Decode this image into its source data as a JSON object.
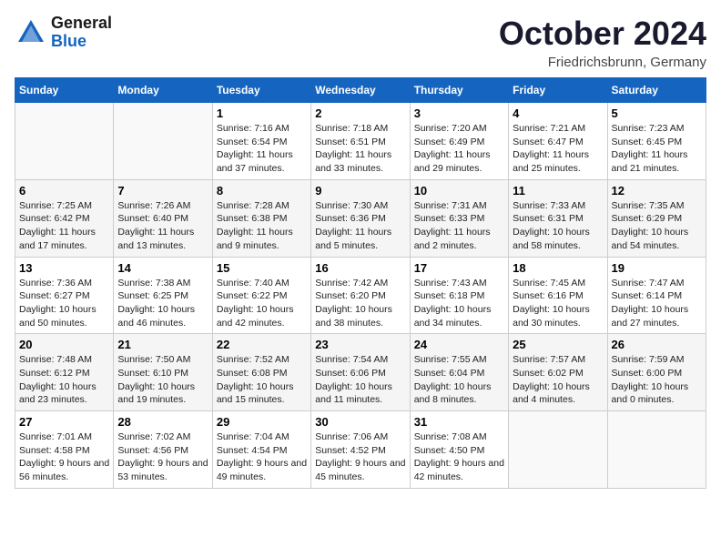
{
  "header": {
    "logo_general": "General",
    "logo_blue": "Blue",
    "month_title": "October 2024",
    "location": "Friedrichsbrunn, Germany"
  },
  "days_of_week": [
    "Sunday",
    "Monday",
    "Tuesday",
    "Wednesday",
    "Thursday",
    "Friday",
    "Saturday"
  ],
  "weeks": [
    [
      {
        "day": "",
        "info": ""
      },
      {
        "day": "",
        "info": ""
      },
      {
        "day": "1",
        "info": "Sunrise: 7:16 AM\nSunset: 6:54 PM\nDaylight: 11 hours\nand 37 minutes."
      },
      {
        "day": "2",
        "info": "Sunrise: 7:18 AM\nSunset: 6:51 PM\nDaylight: 11 hours\nand 33 minutes."
      },
      {
        "day": "3",
        "info": "Sunrise: 7:20 AM\nSunset: 6:49 PM\nDaylight: 11 hours\nand 29 minutes."
      },
      {
        "day": "4",
        "info": "Sunrise: 7:21 AM\nSunset: 6:47 PM\nDaylight: 11 hours\nand 25 minutes."
      },
      {
        "day": "5",
        "info": "Sunrise: 7:23 AM\nSunset: 6:45 PM\nDaylight: 11 hours\nand 21 minutes."
      }
    ],
    [
      {
        "day": "6",
        "info": "Sunrise: 7:25 AM\nSunset: 6:42 PM\nDaylight: 11 hours\nand 17 minutes."
      },
      {
        "day": "7",
        "info": "Sunrise: 7:26 AM\nSunset: 6:40 PM\nDaylight: 11 hours\nand 13 minutes."
      },
      {
        "day": "8",
        "info": "Sunrise: 7:28 AM\nSunset: 6:38 PM\nDaylight: 11 hours\nand 9 minutes."
      },
      {
        "day": "9",
        "info": "Sunrise: 7:30 AM\nSunset: 6:36 PM\nDaylight: 11 hours\nand 5 minutes."
      },
      {
        "day": "10",
        "info": "Sunrise: 7:31 AM\nSunset: 6:33 PM\nDaylight: 11 hours\nand 2 minutes."
      },
      {
        "day": "11",
        "info": "Sunrise: 7:33 AM\nSunset: 6:31 PM\nDaylight: 10 hours\nand 58 minutes."
      },
      {
        "day": "12",
        "info": "Sunrise: 7:35 AM\nSunset: 6:29 PM\nDaylight: 10 hours\nand 54 minutes."
      }
    ],
    [
      {
        "day": "13",
        "info": "Sunrise: 7:36 AM\nSunset: 6:27 PM\nDaylight: 10 hours\nand 50 minutes."
      },
      {
        "day": "14",
        "info": "Sunrise: 7:38 AM\nSunset: 6:25 PM\nDaylight: 10 hours\nand 46 minutes."
      },
      {
        "day": "15",
        "info": "Sunrise: 7:40 AM\nSunset: 6:22 PM\nDaylight: 10 hours\nand 42 minutes."
      },
      {
        "day": "16",
        "info": "Sunrise: 7:42 AM\nSunset: 6:20 PM\nDaylight: 10 hours\nand 38 minutes."
      },
      {
        "day": "17",
        "info": "Sunrise: 7:43 AM\nSunset: 6:18 PM\nDaylight: 10 hours\nand 34 minutes."
      },
      {
        "day": "18",
        "info": "Sunrise: 7:45 AM\nSunset: 6:16 PM\nDaylight: 10 hours\nand 30 minutes."
      },
      {
        "day": "19",
        "info": "Sunrise: 7:47 AM\nSunset: 6:14 PM\nDaylight: 10 hours\nand 27 minutes."
      }
    ],
    [
      {
        "day": "20",
        "info": "Sunrise: 7:48 AM\nSunset: 6:12 PM\nDaylight: 10 hours\nand 23 minutes."
      },
      {
        "day": "21",
        "info": "Sunrise: 7:50 AM\nSunset: 6:10 PM\nDaylight: 10 hours\nand 19 minutes."
      },
      {
        "day": "22",
        "info": "Sunrise: 7:52 AM\nSunset: 6:08 PM\nDaylight: 10 hours\nand 15 minutes."
      },
      {
        "day": "23",
        "info": "Sunrise: 7:54 AM\nSunset: 6:06 PM\nDaylight: 10 hours\nand 11 minutes."
      },
      {
        "day": "24",
        "info": "Sunrise: 7:55 AM\nSunset: 6:04 PM\nDaylight: 10 hours\nand 8 minutes."
      },
      {
        "day": "25",
        "info": "Sunrise: 7:57 AM\nSunset: 6:02 PM\nDaylight: 10 hours\nand 4 minutes."
      },
      {
        "day": "26",
        "info": "Sunrise: 7:59 AM\nSunset: 6:00 PM\nDaylight: 10 hours\nand 0 minutes."
      }
    ],
    [
      {
        "day": "27",
        "info": "Sunrise: 7:01 AM\nSunset: 4:58 PM\nDaylight: 9 hours\nand 56 minutes."
      },
      {
        "day": "28",
        "info": "Sunrise: 7:02 AM\nSunset: 4:56 PM\nDaylight: 9 hours\nand 53 minutes."
      },
      {
        "day": "29",
        "info": "Sunrise: 7:04 AM\nSunset: 4:54 PM\nDaylight: 9 hours\nand 49 minutes."
      },
      {
        "day": "30",
        "info": "Sunrise: 7:06 AM\nSunset: 4:52 PM\nDaylight: 9 hours\nand 45 minutes."
      },
      {
        "day": "31",
        "info": "Sunrise: 7:08 AM\nSunset: 4:50 PM\nDaylight: 9 hours\nand 42 minutes."
      },
      {
        "day": "",
        "info": ""
      },
      {
        "day": "",
        "info": ""
      }
    ]
  ]
}
